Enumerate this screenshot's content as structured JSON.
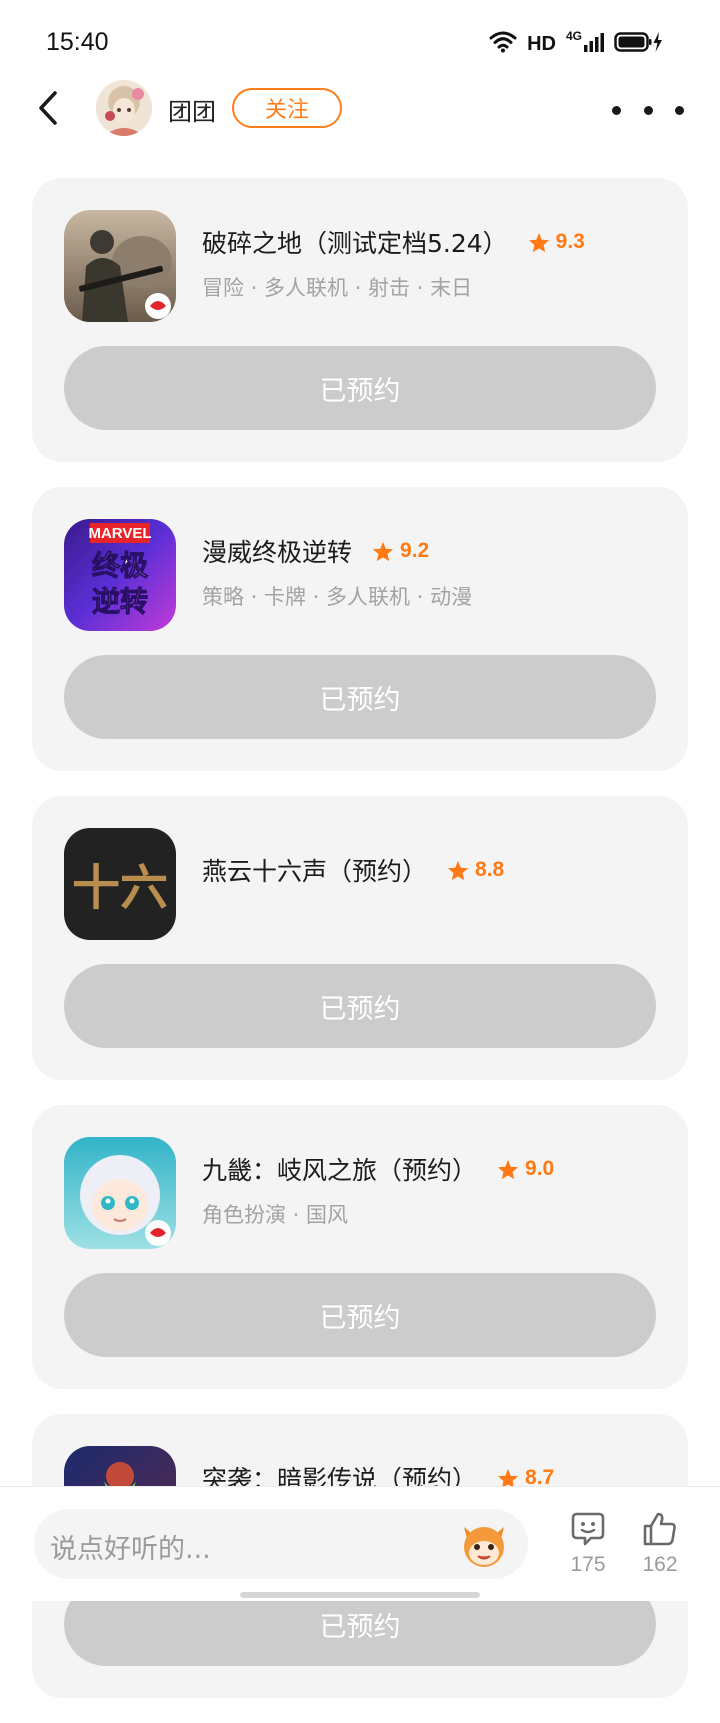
{
  "status_bar": {
    "time": "15:40",
    "hd": "HD",
    "network": "4G",
    "icons": [
      "wifi-icon",
      "signal-icon",
      "battery-charging-icon"
    ]
  },
  "header": {
    "user_name": "团团",
    "follow_label": "关注",
    "icons": [
      "back-arrow-icon",
      "more-icon"
    ]
  },
  "colors": {
    "accent": "#ff7e1c",
    "card_bg": "#f4f4f4",
    "reserved_button_bg": "#cccccc"
  },
  "games": [
    {
      "title": "破碎之地（测试定档5.24）",
      "rating": "9.3",
      "tags": "冒险 · 多人联机 · 射击 · 末日",
      "button_label": "已预约"
    },
    {
      "title": "漫威终极逆转",
      "rating": "9.2",
      "tags": "策略 · 卡牌 · 多人联机 · 动漫",
      "button_label": "已预约"
    },
    {
      "title": "燕云十六声（预约）",
      "rating": "8.8",
      "tags": "",
      "button_label": "已预约"
    },
    {
      "title": "九畿：岐风之旅（预约）",
      "rating": "9.0",
      "tags": "角色扮演 · 国风",
      "button_label": "已预约"
    },
    {
      "title": "突袭：暗影传说（预约）",
      "rating": "8.7",
      "tags": "",
      "button_label": "已预约"
    }
  ],
  "icon_text": {
    "marvel": "MARVEL",
    "marvel_line1": "终极",
    "marvel_line2": "逆转",
    "yanyun": "十六"
  },
  "bottom_bar": {
    "comment_placeholder": "说点好听的...",
    "comment_count": "175",
    "like_count": "162",
    "icons": [
      "mascot-icon",
      "comment-icon",
      "thumbs-up-icon"
    ]
  }
}
